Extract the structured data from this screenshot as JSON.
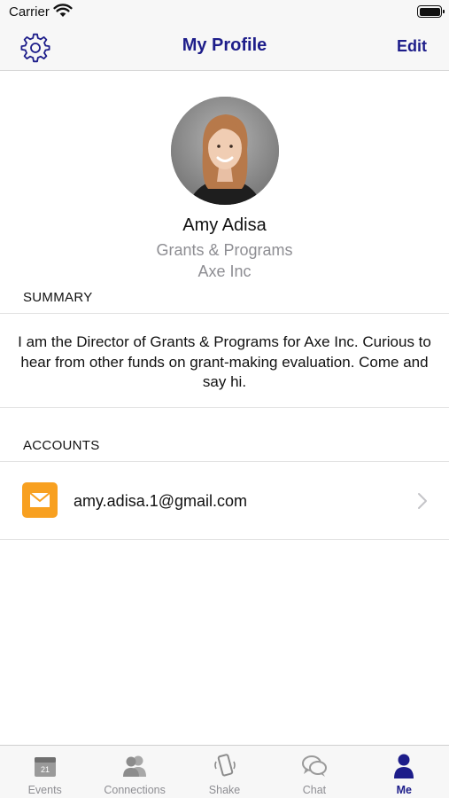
{
  "status_bar": {
    "carrier": "Carrier"
  },
  "nav": {
    "title": "My Profile",
    "edit_label": "Edit",
    "settings_icon": "gear-icon"
  },
  "profile": {
    "name": "Amy Adisa",
    "role": "Grants & Programs",
    "company": "Axe Inc"
  },
  "summary": {
    "header": "SUMMARY",
    "text": "I am the Director of Grants & Programs for Axe Inc. Curious to hear from other funds on grant-making evaluation. Come and say hi."
  },
  "accounts": {
    "header": "ACCOUNTS",
    "items": [
      {
        "email": "amy.adisa.1@gmail.com",
        "icon": "mail-icon"
      }
    ]
  },
  "tabs": [
    {
      "label": "Events",
      "icon": "calendar-icon",
      "calendar_day": "21",
      "active": false
    },
    {
      "label": "Connections",
      "icon": "people-icon",
      "active": false
    },
    {
      "label": "Shake",
      "icon": "phone-shake-icon",
      "active": false
    },
    {
      "label": "Chat",
      "icon": "chat-bubbles-icon",
      "active": false
    },
    {
      "label": "Me",
      "icon": "person-icon",
      "active": true
    }
  ],
  "colors": {
    "accent": "#1d1d8a",
    "mail_icon_bg": "#f8a020",
    "secondary_text": "#8e8e93",
    "bar_bg": "#f7f7f7"
  }
}
